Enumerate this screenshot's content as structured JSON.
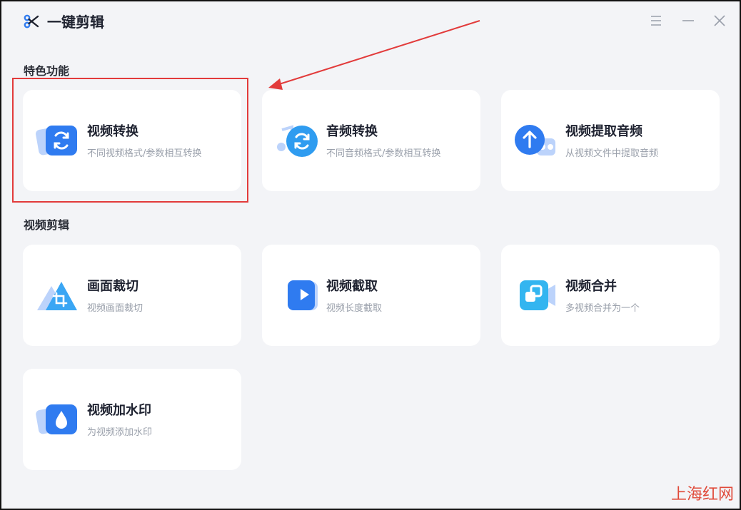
{
  "window": {
    "title": "一键剪辑"
  },
  "sections": [
    {
      "title": "特色功能",
      "cards": [
        {
          "label": "视频转换",
          "desc": "不同视频格式/参数相互转换",
          "icon": "video-convert-icon"
        },
        {
          "label": "音频转换",
          "desc": "不同音频格式/参数相互转换",
          "icon": "audio-convert-icon"
        },
        {
          "label": "视频提取音频",
          "desc": "从视频文件中提取音频",
          "icon": "extract-audio-icon"
        }
      ]
    },
    {
      "title": "视频剪辑",
      "cards": [
        {
          "label": "画面裁切",
          "desc": "视频画面裁切",
          "icon": "crop-icon"
        },
        {
          "label": "视频截取",
          "desc": "视频长度截取",
          "icon": "video-trim-icon"
        },
        {
          "label": "视频合并",
          "desc": "多视频合并为一个",
          "icon": "video-merge-icon"
        },
        {
          "label": "视频加水印",
          "desc": "为视频添加水印",
          "icon": "watermark-icon"
        }
      ]
    }
  ],
  "watermark": "上海红网",
  "colors": {
    "accent": "#2f7bf0",
    "background": "#f3f4f7",
    "card": "#ffffff",
    "highlight": "#e23b3b"
  }
}
